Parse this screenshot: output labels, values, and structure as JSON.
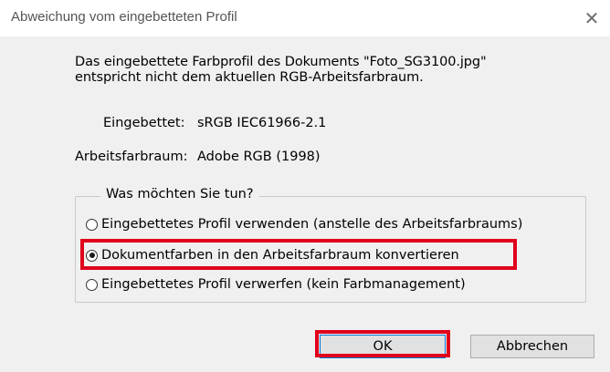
{
  "window": {
    "title": "Abweichung vom eingebetteten Profil",
    "close_glyph": "✕"
  },
  "message": {
    "line1": "Das eingebettete Farbprofil des Dokuments \"Foto_SG3100.jpg\"",
    "line2": "entspricht nicht dem aktuellen RGB-Arbeitsfarbraum."
  },
  "info": {
    "embedded_label": "Eingebettet:",
    "embedded_value": "sRGB IEC61966-2.1",
    "working_label": "Arbeitsfarbraum:",
    "working_value": "Adobe RGB (1998)"
  },
  "group": {
    "legend": "Was möchten Sie tun?",
    "options": [
      {
        "label": "Eingebettetes Profil verwenden (anstelle des Arbeitsfarbraums)",
        "selected": false
      },
      {
        "label": "Dokumentfarben in den Arbeitsfarbraum konvertieren",
        "selected": true
      },
      {
        "label": "Eingebettetes Profil verwerfen (kein Farbmanagement)",
        "selected": false
      }
    ]
  },
  "buttons": {
    "ok": "OK",
    "cancel": "Abbrechen"
  },
  "colors": {
    "annotation": "#e0001b",
    "background": "#f0f0f0"
  }
}
